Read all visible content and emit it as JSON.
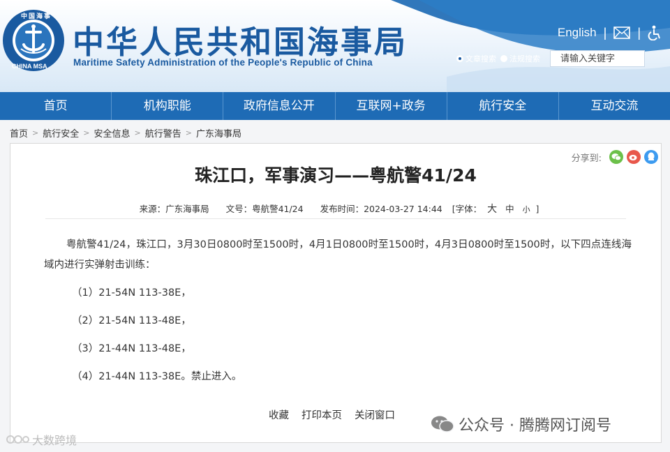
{
  "header": {
    "title_cn": "中华人民共和国海事局",
    "title_en": "Maritime Safety Administration of the People's Republic of China",
    "emblem_top_text": "中国海事",
    "emblem_bottom_text": "CHINA MSA",
    "english_link": "English",
    "separator": "|",
    "search": {
      "option_article": "文章搜索",
      "option_regulation": "法规搜索",
      "placeholder": "请输入关键字"
    }
  },
  "nav": {
    "items": [
      {
        "label": "首页"
      },
      {
        "label": "机构职能"
      },
      {
        "label": "政府信息公开"
      },
      {
        "label": "互联网+政务"
      },
      {
        "label": "航行安全"
      },
      {
        "label": "互动交流"
      }
    ]
  },
  "breadcrumb": {
    "items": [
      "首页",
      "航行安全",
      "安全信息",
      "航行警告",
      "广东海事局"
    ],
    "separator": ">"
  },
  "article": {
    "share_label": "分享到:",
    "title": "珠江口，军事演习——粤航警41/24",
    "meta": {
      "source": "来源：广东海事局",
      "doc_no": "文号：粤航警41/24",
      "published": "发布时间：2024-03-27 14:44",
      "font_label": "[字体：",
      "font_large": "大",
      "font_medium": "中",
      "font_small": "小",
      "font_close": "]"
    },
    "paragraph": "粤航警41/24，珠江口，3月30日0800时至1500时，4月1日0800时至1500时，4月3日0800时至1500时，以下四点连线海域内进行实弹射击训练：",
    "points": [
      "（1）21-54N 113-38E，",
      "（2）21-54N 113-48E，",
      "（3）21-44N 113-48E，",
      "（4）21-44N 113-38E。禁止进入。"
    ],
    "actions": [
      "收藏",
      "打印本页",
      "关闭窗口"
    ]
  },
  "watermarks": {
    "right": "公众号 · 腾腾网订阅号",
    "left": "大数跨境"
  },
  "colors": {
    "brand_blue": "#1a5aa0",
    "nav_blue": "#1e6bb5",
    "wechat_green": "#6cc04a",
    "weibo_red": "#e8574b",
    "qq_blue": "#3d9bf0"
  }
}
